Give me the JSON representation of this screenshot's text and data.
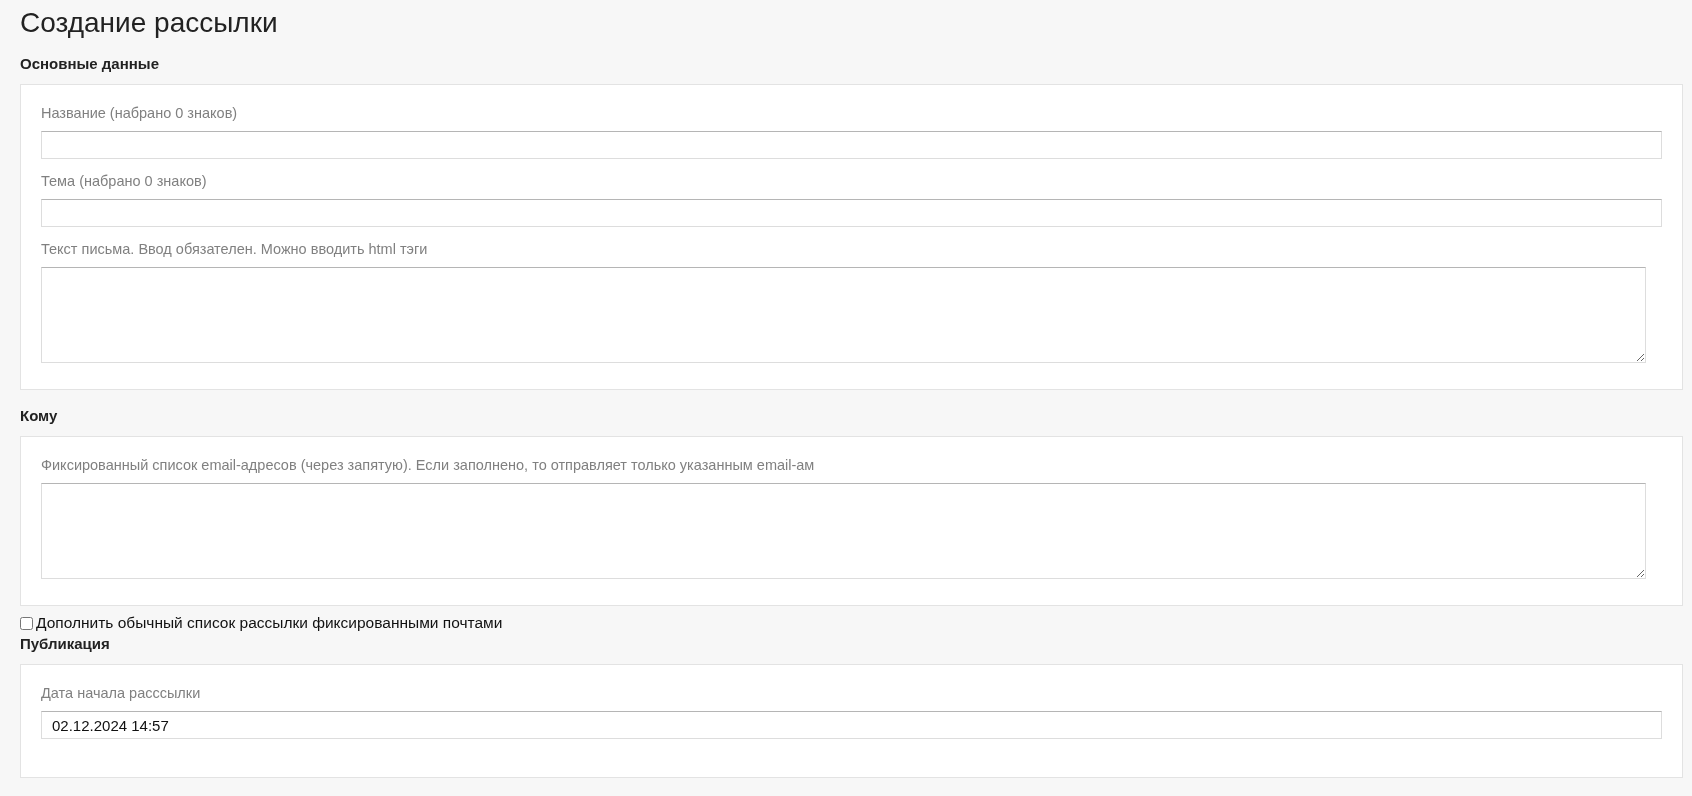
{
  "page": {
    "title": "Создание рассылки"
  },
  "blocks": [
    {
      "kind": "section",
      "title": "Основные данные",
      "fields": [
        {
          "kind": "text",
          "label": "Название (набрано 0 знаков)"
        },
        {
          "kind": "text",
          "label": "Тема (набрано 0 знаков)"
        },
        {
          "kind": "textarea",
          "label": "Текст письма. Ввод обязателен. Можно вводить html тэги"
        }
      ]
    },
    {
      "kind": "section",
      "title": "Кому",
      "fields": [
        {
          "kind": "textarea",
          "label": "Фиксированный список email-адресов (через запятую). Если заполнено, то отправляет только указанным email-ам"
        }
      ]
    },
    {
      "kind": "checkbox",
      "label": "Дополнить обычный список рассылки фиксированными почтами",
      "checked": false
    },
    {
      "kind": "section",
      "title": "Публикация",
      "fields": [
        {
          "kind": "text",
          "label": "Дата начала расссылки",
          "value": "02.12.2024 14:57"
        }
      ]
    }
  ]
}
